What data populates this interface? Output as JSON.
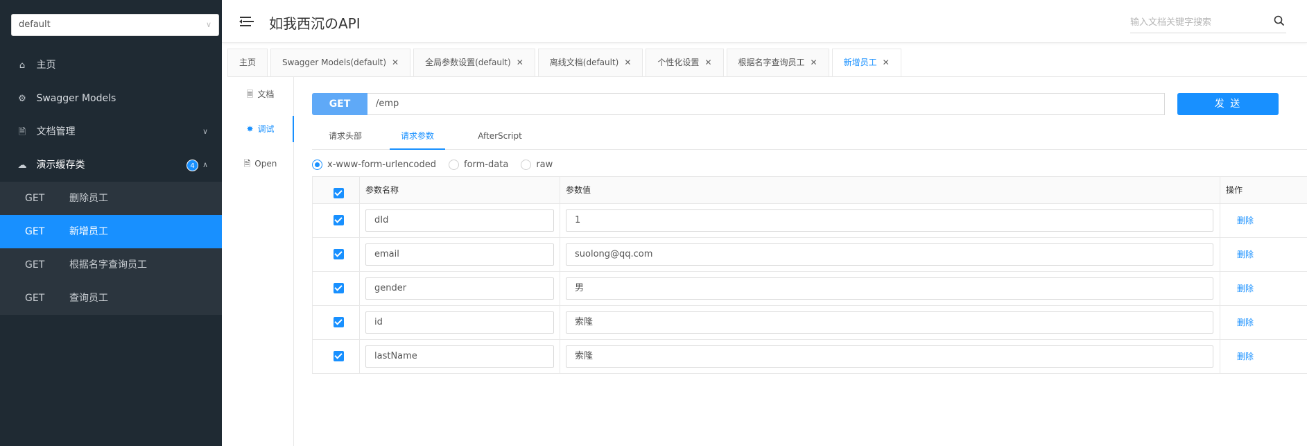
{
  "sidebar": {
    "group_select": "default",
    "menu": {
      "home": "主页",
      "models": "Swagger Models",
      "docs": "文档管理",
      "cache_group": "演示缓存类",
      "cache_count": "4"
    },
    "apis": [
      {
        "method": "GET",
        "name": "删除员工"
      },
      {
        "method": "GET",
        "name": "新增员工"
      },
      {
        "method": "GET",
        "name": "根据名字查询员工"
      },
      {
        "method": "GET",
        "name": "查询员工"
      }
    ]
  },
  "header": {
    "title": "如我西沉のAPI",
    "search_placeholder": "输入文档关键字搜索"
  },
  "tabs": [
    {
      "label": "主页"
    },
    {
      "label": "Swagger Models(default)"
    },
    {
      "label": "全局参数设置(default)"
    },
    {
      "label": "离线文档(default)"
    },
    {
      "label": "个性化设置"
    },
    {
      "label": "根据名字查询员工"
    },
    {
      "label": "新增员工"
    }
  ],
  "vnav": {
    "doc": "文档",
    "debug": "调试",
    "open": "Open"
  },
  "request": {
    "method": "GET",
    "url": "/emp",
    "send": "发 送"
  },
  "subtabs": {
    "headers": "请求头部",
    "params": "请求参数",
    "after_script": "AfterScript"
  },
  "body_types": {
    "urlencoded": "x-www-form-urlencoded",
    "form_data": "form-data",
    "raw": "raw",
    "selected": "x-www-form-urlencoded"
  },
  "table": {
    "columns": {
      "name": "参数名称",
      "value": "参数值",
      "action": "操作"
    },
    "rows": [
      {
        "name": "dId",
        "value": "1",
        "action": "删除"
      },
      {
        "name": "email",
        "value": "suolong@qq.com",
        "action": "删除"
      },
      {
        "name": "gender",
        "value": "男",
        "action": "删除"
      },
      {
        "name": "id",
        "value": "索隆",
        "action": "删除"
      },
      {
        "name": "lastName",
        "value": "索隆",
        "action": "删除"
      }
    ]
  },
  "colors": {
    "sidebar_bg": "#1f2a33",
    "accent": "#1890ff",
    "method_badge": "#5fa9f7"
  }
}
